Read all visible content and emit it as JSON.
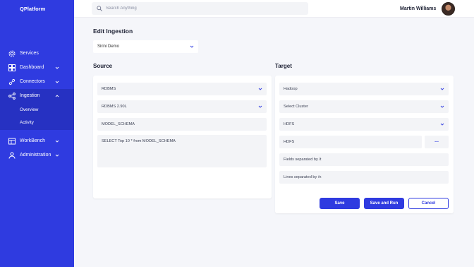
{
  "app": {
    "brand": "QPlatform"
  },
  "sidebar": {
    "items": [
      {
        "label": "Services"
      },
      {
        "label": "Dashboard"
      },
      {
        "label": "Connectors"
      },
      {
        "label": "Ingestion"
      },
      {
        "label": "WorkBench"
      },
      {
        "label": "Administration"
      }
    ],
    "sub_items": [
      {
        "label": "Overview"
      },
      {
        "label": "Activity"
      }
    ],
    "accent": "#2f3be0"
  },
  "header": {
    "search_placeholder": "Search Anything",
    "user_name": "Martin Williams"
  },
  "main": {
    "title": "Edit Ingestion",
    "ingestion_select": "Sirini Demo",
    "source": {
      "title": "Source",
      "type": "RDBMS",
      "connection": "RDBMS 2.90L",
      "schema": "MODEL_SCHEMA",
      "query": "SELECT Top 10 * from MODEL_SCHEMA"
    },
    "target": {
      "title": "Target",
      "type": "Hadoop",
      "cluster": "Select Cluster",
      "format": "HDFS",
      "path": "HDFS",
      "browse_label": "...",
      "fields_sep": "Fields separated by /t",
      "lines_sep": "Lines separated by /n"
    },
    "buttons": {
      "save": "Save",
      "save_run": "Save and Run",
      "cancel": "Cancel"
    }
  }
}
